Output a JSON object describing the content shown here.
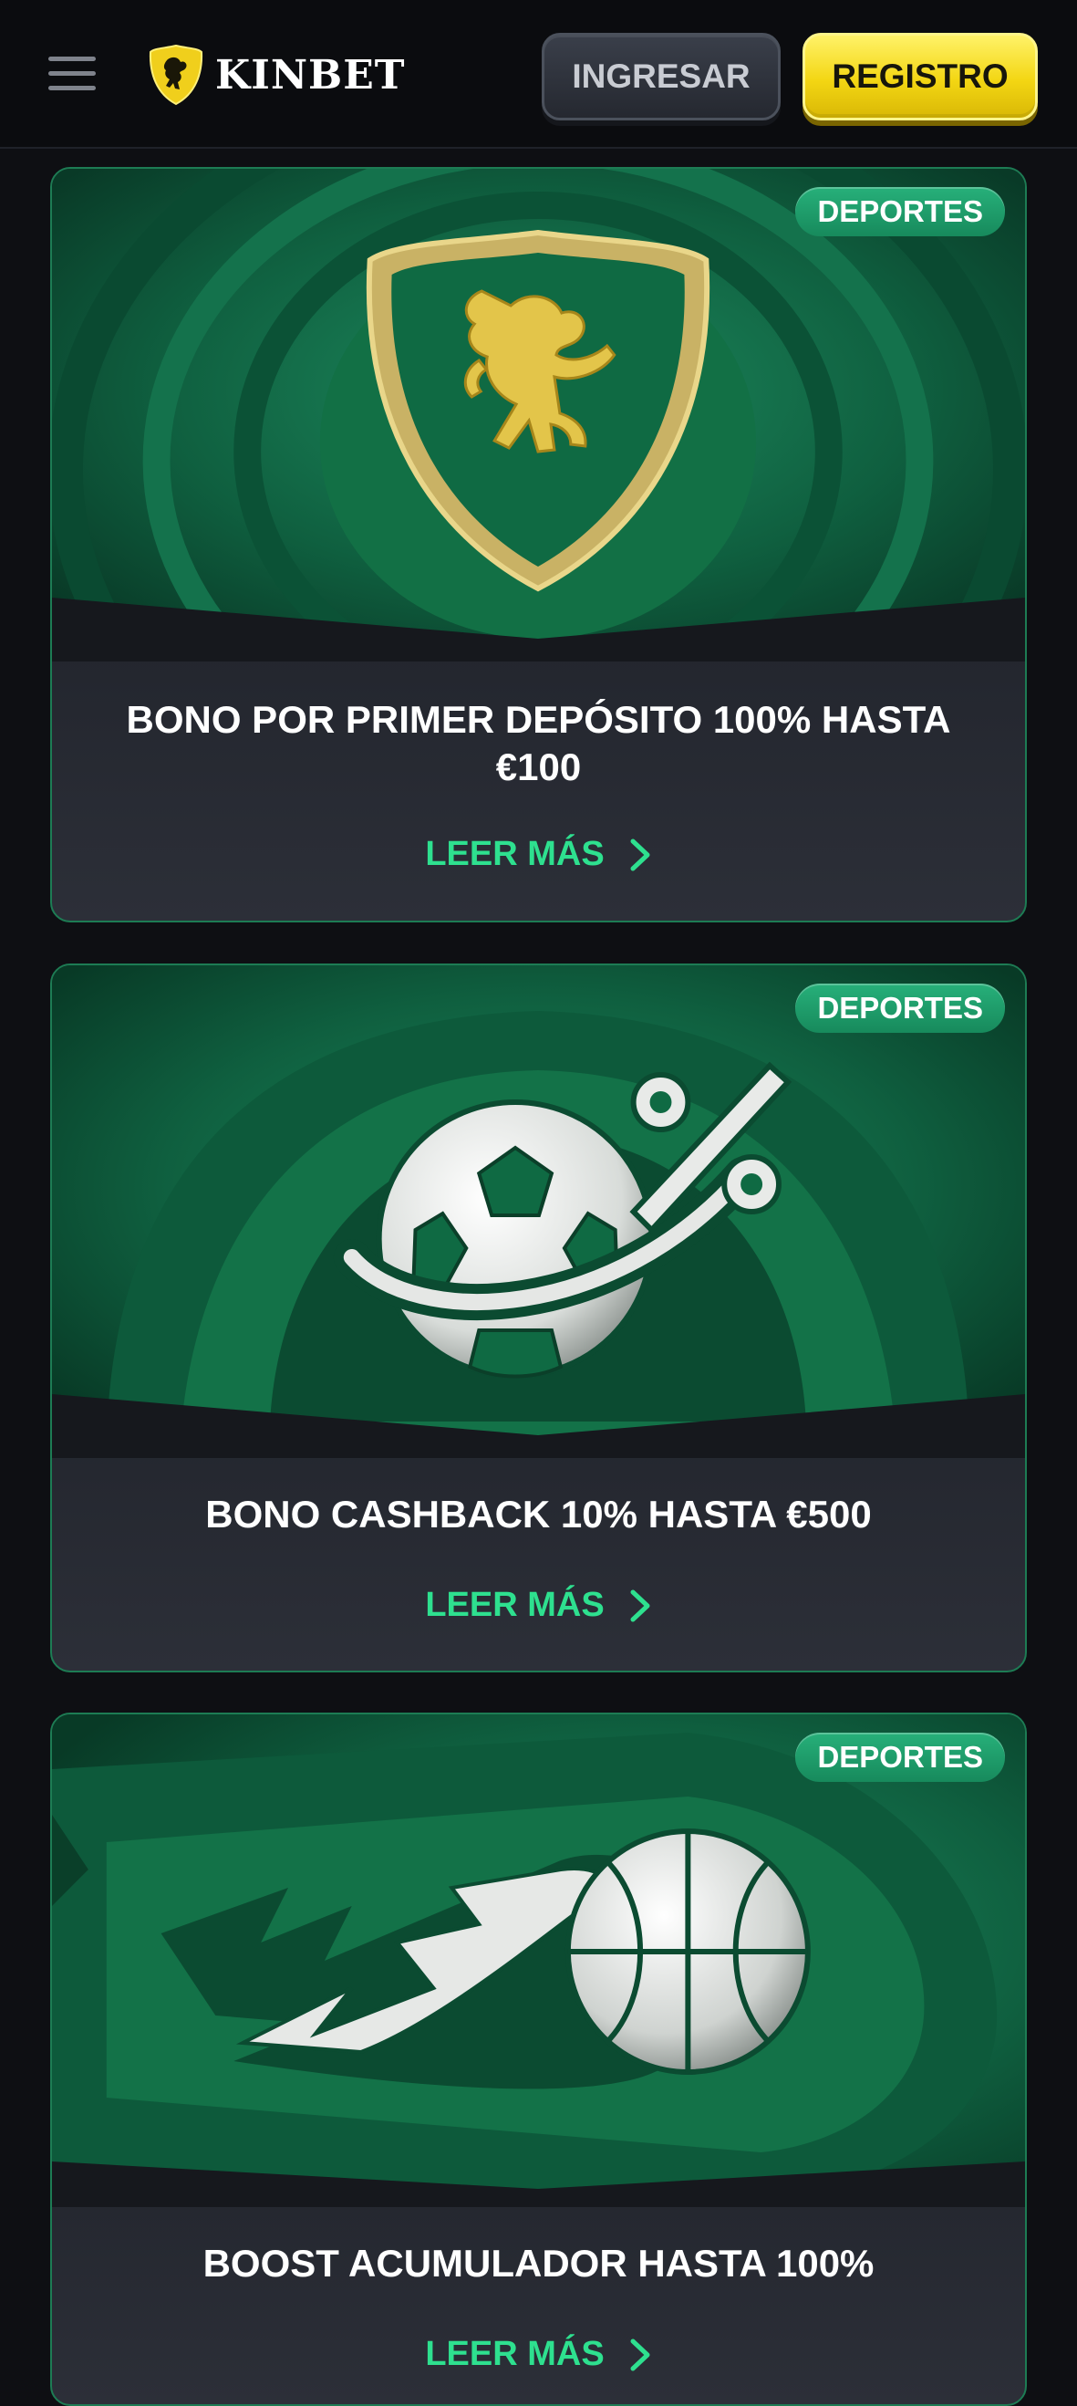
{
  "header": {
    "brand": "KINBET",
    "login_label": "INGRESAR",
    "register_label": "REGISTRO"
  },
  "promotions": [
    {
      "badge": "DEPORTES",
      "title": "BONO POR PRIMER DEPÓSITO 100% HASTA €100",
      "link": "LEER MÁS",
      "icon": "lion-shield-icon"
    },
    {
      "badge": "DEPORTES",
      "title": "BONO CASHBACK 10% HASTA €500",
      "link": "LEER MÁS",
      "icon": "soccer-ball-percent-icon"
    },
    {
      "badge": "DEPORTES",
      "title": "BOOST ACUMULADOR HASTA 100%",
      "link": "LEER MÁS",
      "icon": "basketball-bolt-icon"
    }
  ],
  "colors": {
    "background": "#0e0f13",
    "accent_green": "#2ee08f",
    "brand_yellow": "#f3d613"
  }
}
